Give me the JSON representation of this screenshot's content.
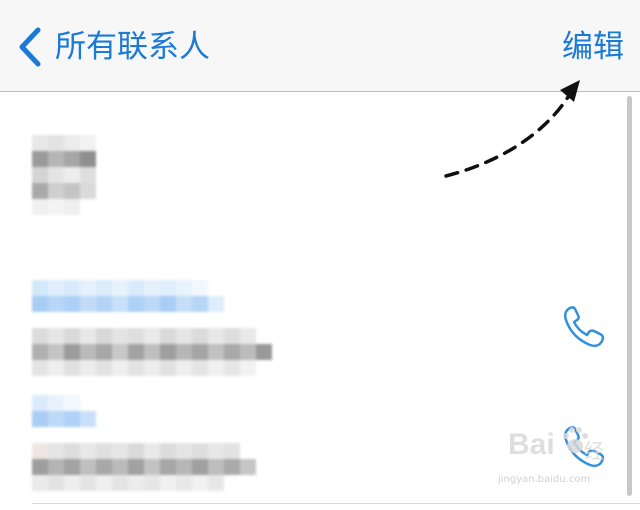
{
  "navbar": {
    "back_label": "所有联系人",
    "edit_label": "编辑"
  },
  "watermark": {
    "logo_text": "Bai 经验",
    "url": "jingyan.baidu.com"
  },
  "colors": {
    "ios_blue": "#1a7ad6",
    "phone_icon": "#2f8fe0"
  },
  "icons": [
    "chevron-left-icon",
    "phone-icon",
    "phone-icon"
  ]
}
